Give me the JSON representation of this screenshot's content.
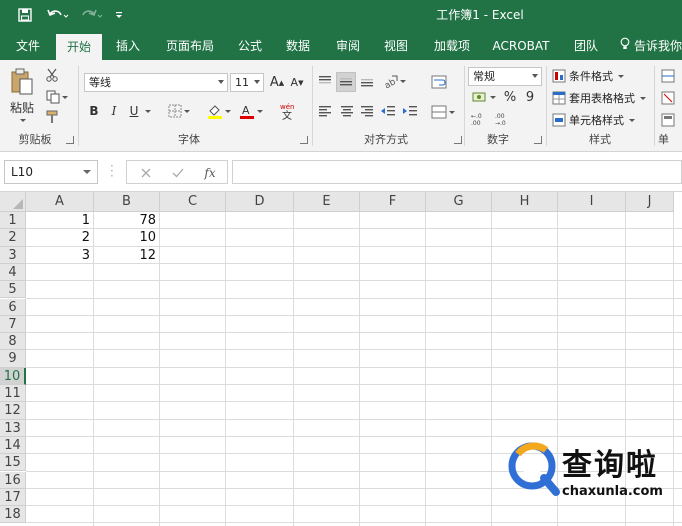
{
  "window": {
    "title": "工作簿1  -  Excel"
  },
  "tabs": [
    {
      "label": "文件",
      "active": false
    },
    {
      "label": "开始",
      "active": true
    },
    {
      "label": "插入",
      "active": false
    },
    {
      "label": "页面布局",
      "active": false
    },
    {
      "label": "公式",
      "active": false
    },
    {
      "label": "数据",
      "active": false
    },
    {
      "label": "审阅",
      "active": false
    },
    {
      "label": "视图",
      "active": false
    },
    {
      "label": "加载项",
      "active": false
    },
    {
      "label": "ACROBAT",
      "active": false
    },
    {
      "label": "团队",
      "active": false
    }
  ],
  "tell_me": "告诉我你",
  "ribbon": {
    "clipboard": {
      "paste_label": "粘贴",
      "group_label": "剪贴板"
    },
    "font": {
      "font_name": "等线",
      "font_size": "11",
      "group_label": "字体",
      "bold": "B",
      "italic": "I",
      "underline": "U"
    },
    "alignment": {
      "group_label": "对齐方式"
    },
    "number": {
      "format": "常规",
      "group_label": "数字",
      "percent": "%",
      "comma": "9"
    },
    "styles": {
      "conditional_format": "条件格式",
      "format_as_table": "套用表格格式",
      "cell_styles": "单元格样式",
      "group_label": "样式"
    },
    "cells_partial": "单"
  },
  "formula_bar": {
    "name_box": "L10",
    "formula": "",
    "fx_label": "fx"
  },
  "sheet": {
    "columns": [
      "A",
      "B",
      "C",
      "D",
      "E",
      "F",
      "G",
      "H",
      "I",
      "J"
    ],
    "rows": [
      "1",
      "2",
      "3",
      "4",
      "5",
      "6",
      "7",
      "8",
      "9",
      "10",
      "11",
      "12",
      "13",
      "14",
      "15",
      "16",
      "17",
      "18"
    ],
    "selected_row": "10",
    "cells": {
      "A1": "1",
      "B1": "78",
      "A2": "2",
      "B2": "10",
      "A3": "3",
      "B3": "12"
    }
  },
  "watermark": {
    "text": "查询啦",
    "url": "chaxunla.com"
  },
  "colors": {
    "excel_green": "#217346",
    "ribbon_bg": "#f3f3f3",
    "grid_line": "#dcdcdc"
  }
}
